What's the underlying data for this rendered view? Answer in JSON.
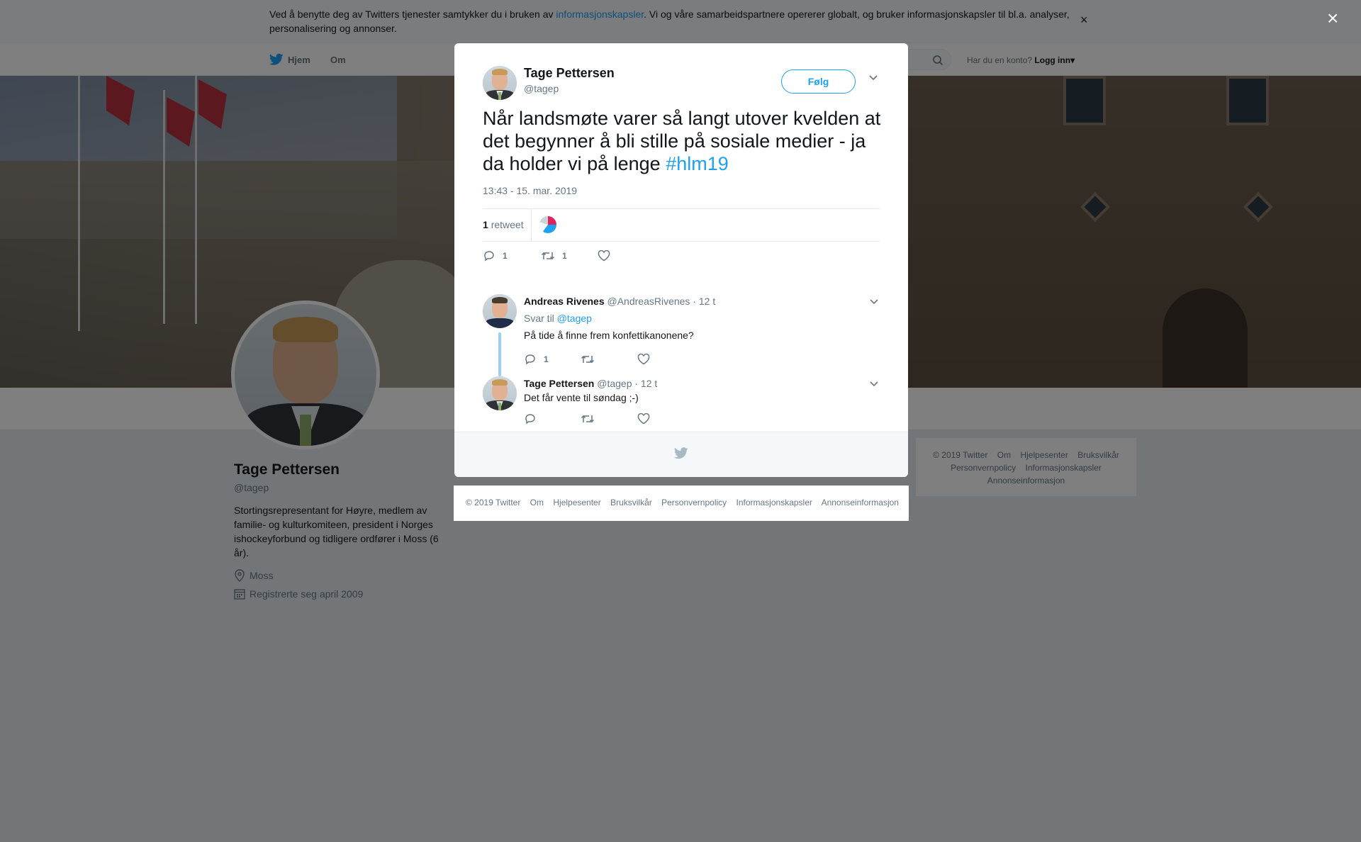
{
  "cookie_bar": {
    "text_before": "Ved å benytte deg av Twitters tjenester samtykker du i bruken av ",
    "link": "informasjonskapsler",
    "text_after": ". Vi og våre samarbeidspartnere opererer globalt, og bruker informasjonskapsler til bl.a. analyser, personalisering og annonser.",
    "close": "×"
  },
  "nav": {
    "home": "Hjem",
    "about": "Om",
    "account_prompt": "Har du en konto?",
    "login": "Logg inn",
    "login_caret": "▾"
  },
  "profile": {
    "name": "Tage Pettersen",
    "handle": "@tagep",
    "bio": "Stortingsrepresentant for Høyre, medlem av familie- og kulturkomiteen, president i Norges ishockeyforbund og tidligere ordfører i Moss (6 år).",
    "location": "Moss",
    "joined": "Registrerte seg april 2009"
  },
  "side_footer": {
    "links": [
      "© 2019 Twitter",
      "Om",
      "Hjelpesenter",
      "Bruksvilkår",
      "Personvernpolicy",
      "Informasjonskapsler",
      "Annonseinformasjon"
    ]
  },
  "overlay": {
    "close": "×"
  },
  "tweet": {
    "author_name": "Tage Pettersen",
    "author_handle": "@tagep",
    "follow_label": "Følg",
    "text": "Når landsmøte varer så langt utover kvelden at det begynner å bli stille på sosiale medier - ja da holder vi på lenge ",
    "hashtag": "#hlm19",
    "timestamp": "13:43 - 15. mar. 2019",
    "retweet_count": "1",
    "retweet_label": "retweet",
    "actions": {
      "replies": "1",
      "retweets": "1",
      "likes": ""
    }
  },
  "replies": [
    {
      "name": "Andreas Rivenes",
      "handle": "@AndreasRivenes",
      "time": "· 12 t",
      "reply_to_label": "Svar til",
      "reply_to_handle": "@tagep",
      "text": "På tide å finne frem konfettikanonene?",
      "replies": "1",
      "retweets": "",
      "likes": ""
    },
    {
      "name": "Tage Pettersen",
      "handle": "@tagep",
      "time": "· 12 t",
      "text": "Det får vente til søndag ;-)",
      "replies": "",
      "retweets": "",
      "likes": ""
    }
  ],
  "modal_footer": {
    "links": [
      "© 2019 Twitter",
      "Om",
      "Hjelpesenter",
      "Bruksvilkår",
      "Personvernpolicy",
      "Informasjonskapsler",
      "Annonseinformasjon"
    ]
  },
  "colors": {
    "accent": "#1da1f2",
    "text": "#14171a",
    "muted": "#657786",
    "page_bg": "#e6ecf0",
    "overlay": "rgba(0,0,0,0.5)"
  },
  "icons": [
    "twitter-bird-icon",
    "search-icon",
    "chevron-down-icon",
    "reply-icon",
    "retweet-icon",
    "heart-icon",
    "location-pin-icon",
    "calendar-icon",
    "close-icon"
  ]
}
